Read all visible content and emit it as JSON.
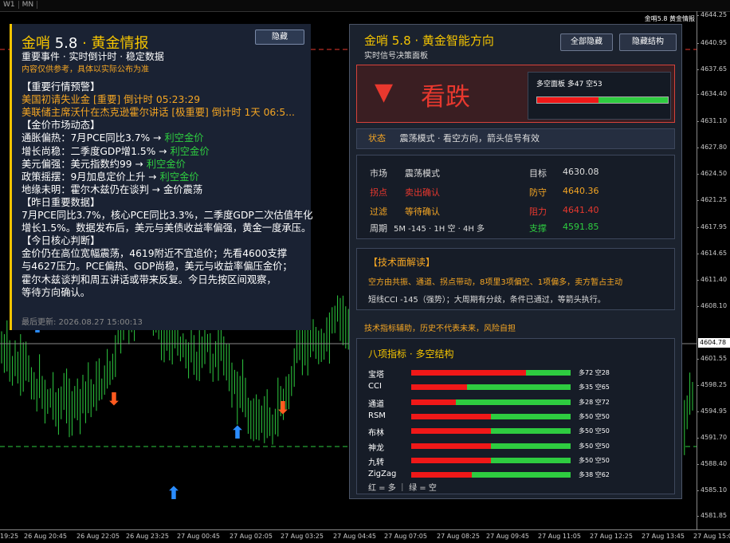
{
  "topbar": {
    "tabs": [
      "W1",
      "MN"
    ]
  },
  "chart_header": "金哨5.8 黄金情报",
  "y_axis": [
    "4644.25",
    "4640.95",
    "4637.65",
    "4634.40",
    "4631.10",
    "4627.80",
    "4624.50",
    "4621.25",
    "4617.95",
    "4614.65",
    "4611.40",
    "4608.10",
    "4601.55",
    "4598.25",
    "4594.95",
    "4591.70",
    "4588.40",
    "4585.10",
    "4581.85"
  ],
  "price_tags": {
    "current": "4604.78"
  },
  "x_axis": [
    "19:25",
    "26 Aug 20:45",
    "26 Aug 22:05",
    "26 Aug 23:25",
    "27 Aug 00:45",
    "27 Aug 02:05",
    "27 Aug 03:25",
    "27 Aug 04:45",
    "27 Aug 07:05",
    "27 Aug 08:25",
    "27 Aug 09:45",
    "27 Aug 11:05",
    "27 Aug 12:25",
    "27 Aug 13:45",
    "27 Aug 15:05"
  ],
  "left_panel": {
    "title_brand": "金哨",
    "title_ver": "5.8",
    "title_dot": " · ",
    "title_name": "黄金情报",
    "hide_label": "隐藏",
    "subtitle": "重要事件 · 实时倒计时 · 稳定数据",
    "warning": "内容仅供参考，具体以实际公布为准",
    "lines": [
      {
        "text": "【重要行情预警】",
        "color": "white"
      },
      {
        "text": "美国初请失业金 [重要] 倒计时 05:23:29",
        "color": "orange"
      },
      {
        "text": "美联储主席沃什在杰克逊霍尔讲话 [极重要] 倒计时 1天 06:5...",
        "color": "orange"
      },
      {
        "text": "【金价市场动态】",
        "color": "white"
      },
      {
        "text": "通胀偏热：7月PCE同比3.7%  →  ",
        "tail": "利空金价",
        "color": "white"
      },
      {
        "text": "增长尚稳：二季度GDP增1.5%  →  ",
        "tail": "利空金价",
        "color": "white"
      },
      {
        "text": "美元偏强：美元指数约99  →  ",
        "tail": "利空金价",
        "color": "white"
      },
      {
        "text": "政策摇摆：9月加息定价上升  →  ",
        "tail": "利空金价",
        "color": "white"
      },
      {
        "text": "地缘未明：霍尔木兹仍在谈判  →  金价震荡",
        "color": "white"
      },
      {
        "text": "【昨日重要数据】",
        "color": "white"
      },
      {
        "text": "7月PCE同比3.7%，核心PCE同比3.3%，二季度GDP二次估值年化",
        "color": "white"
      },
      {
        "text": "增长1.5%。数据发布后，美元与美债收益率偏强，黄金一度承压。",
        "color": "white"
      },
      {
        "text": "【今日核心判断】",
        "color": "white"
      },
      {
        "text": "金价仍在高位宽幅震荡，4619附近不宜追价；先看4600支撑",
        "color": "white"
      },
      {
        "text": "与4627压力。PCE偏热、GDP尚稳，美元与收益率偏压金价；",
        "color": "white"
      },
      {
        "text": "霍尔木兹谈判和周五讲话或带来反复。今日先按区间观察，",
        "color": "white"
      },
      {
        "text": "等待方向确认。",
        "color": "white"
      }
    ],
    "footer": "最后更新: 2026.08.27 15:00:13"
  },
  "right_panel": {
    "title": "金哨 5.8 · 黄金智能方向",
    "subtitle": "实时信号决策面板",
    "btn_hide_all": "全部隐藏",
    "btn_hide_struct": "隐藏结构",
    "signal": {
      "arrow": "▼",
      "label": "看跌",
      "mini_text": "多空面板  多47 空53",
      "bull": 47,
      "bear": 53
    },
    "status_key": "状态",
    "status_val": "震荡模式 · 看空方向，箭头信号有效",
    "market": {
      "k1": "市场",
      "v1": "震荡模式",
      "k2": "目标",
      "v2": "4630.08",
      "k3": "拐点",
      "v3": "卖出确认",
      "k4": "防守",
      "v4": "4640.36",
      "k5": "过滤",
      "v5": "等待确认",
      "k6": "阻力",
      "v6": "4641.40",
      "k7": "周期",
      "v7": "5M -145 · 1H 空 · 4H 多",
      "k8": "支撑",
      "v8": "4591.85"
    },
    "tech": {
      "heading": "【技术面解读】",
      "line1": "空方由共振、通道、拐点带动，8项里3项偏空、1项偏多，卖方暂占主动",
      "line2": "短线CCI -145（强势）；大周期有分歧，条件已通过，等箭头执行。"
    },
    "disclaimer": "技术指标辅助，历史不代表未来，风险自担",
    "indicators_title": "八项指标 · 多空结构",
    "indicators": [
      {
        "name": "宝塔",
        "bull": 72,
        "bear": 28,
        "label": "多72 空28"
      },
      {
        "name": "CCI",
        "bull": 35,
        "bear": 65,
        "label": "多35 空65"
      },
      {
        "name": "通道",
        "bull": 28,
        "bear": 72,
        "label": "多28 空72"
      },
      {
        "name": "RSM",
        "bull": 50,
        "bear": 50,
        "label": "多50 空50"
      },
      {
        "name": "布林",
        "bull": 50,
        "bear": 50,
        "label": "多50 空50"
      },
      {
        "name": "神龙",
        "bull": 50,
        "bear": 50,
        "label": "多50 空50"
      },
      {
        "name": "九转",
        "bull": 50,
        "bear": 50,
        "label": "多50 空50"
      },
      {
        "name": "ZigZag",
        "bull": 38,
        "bear": 62,
        "label": "多38 空62"
      }
    ],
    "legend": "红 = 多  ｜  绿 = 空"
  },
  "colors": {
    "bull": "#f01818",
    "bear": "#2ecc40",
    "accent": "#f5c400",
    "warn": "#f5a623"
  }
}
